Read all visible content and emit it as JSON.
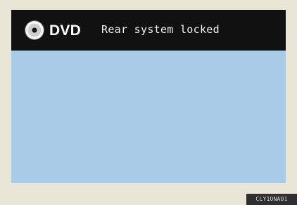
{
  "header": {
    "source_label": "DVD",
    "status_text": "Rear system locked"
  },
  "icons": {
    "source_icon": "disc-icon"
  },
  "badge": {
    "code": "CLY1ONA01"
  },
  "colors": {
    "page_background": "#e9e6d8",
    "screen_background": "#a9cce6",
    "topbar_background": "#111111",
    "text_primary": "#ffffff",
    "badge_background": "#2f2f2f"
  }
}
